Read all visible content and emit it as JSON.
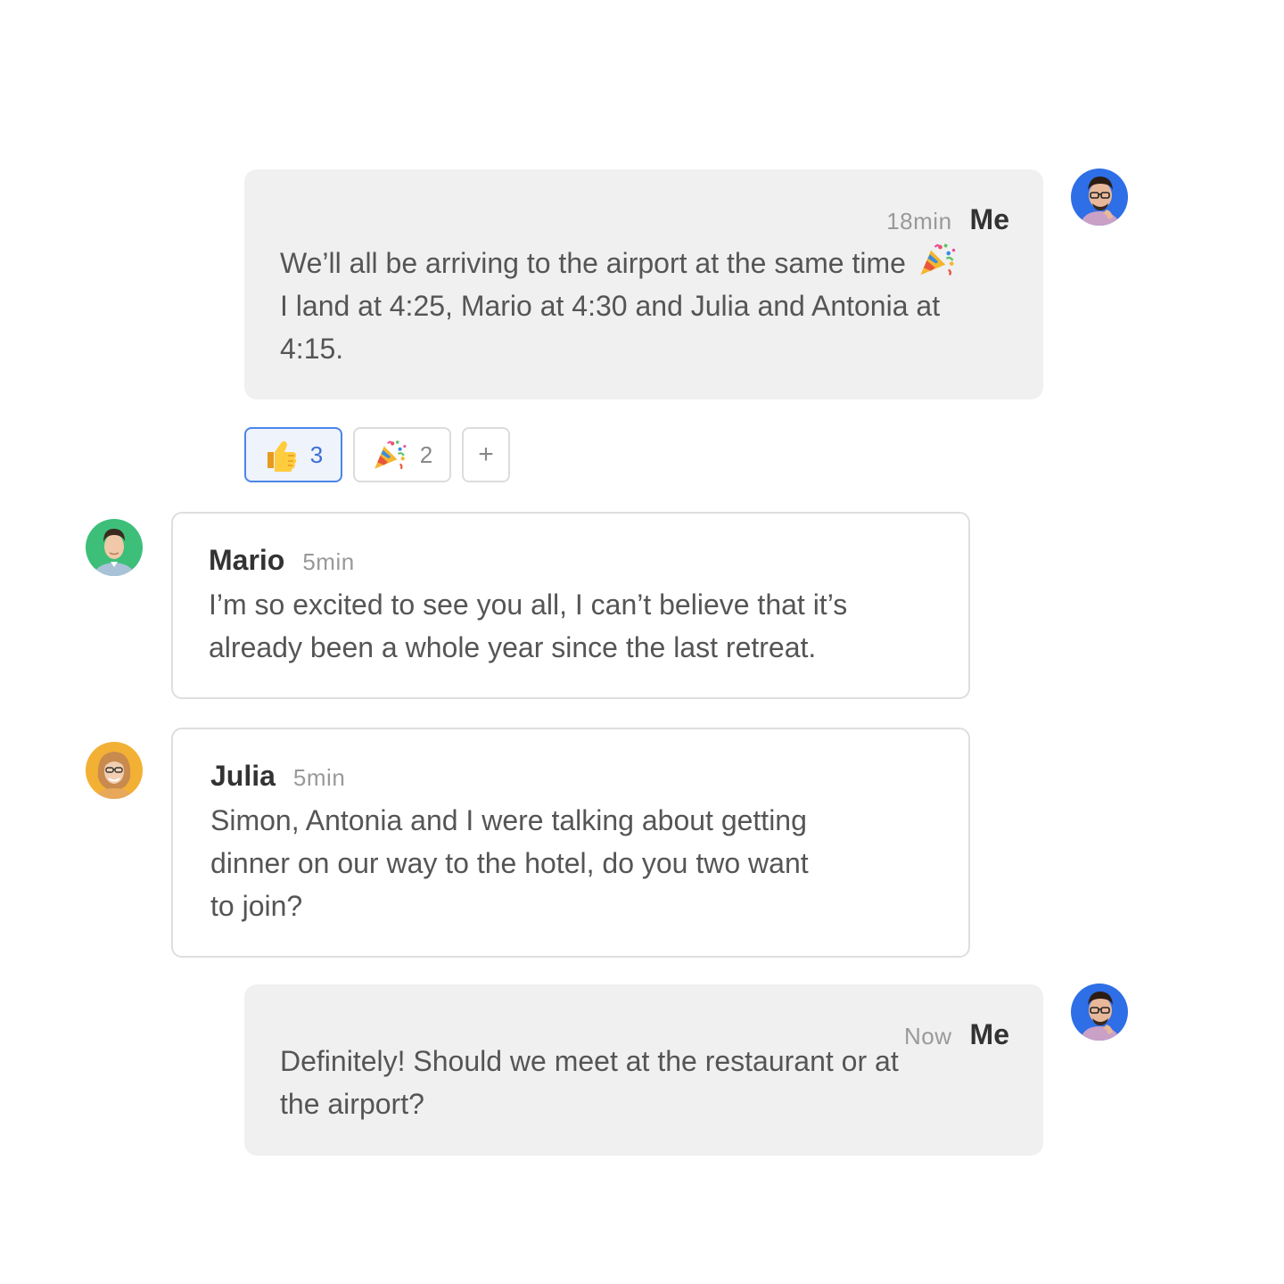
{
  "messages": [
    {
      "sender": "Me",
      "time": "18min",
      "lines": [
        "We’ll all be arriving to the airport at the same time",
        "I land at 4:25, Mario at 4:30 and Julia and Antonia at",
        "4:15."
      ],
      "emoji_icon": "party-popper-icon"
    },
    {
      "sender": "Mario",
      "time": "5min",
      "lines": [
        "I’m so excited to see you all, I can’t believe that it’s",
        "already been a whole year since the last retreat."
      ]
    },
    {
      "sender": "Julia",
      "time": "5min",
      "lines": [
        "Simon, Antonia and I were talking about getting",
        "dinner on our way to the hotel, do you two want",
        "to join?"
      ]
    },
    {
      "sender": "Me",
      "time": "Now",
      "lines": [
        "Definitely! Should we meet at the restaurant or at",
        "the airport?"
      ]
    }
  ],
  "reactions": [
    {
      "icon": "thumbs-up-icon",
      "count": "3",
      "active": true
    },
    {
      "icon": "party-popper-icon",
      "count": "2",
      "active": false
    },
    {
      "label": "+",
      "icon": "add-reaction-icon"
    }
  ],
  "colors": {
    "me_bubble": "#f0f0f0",
    "other_border": "#dedede",
    "active_reaction_border": "#4a86e8",
    "mario_avatar_bg": "#3dbf7a",
    "julia_avatar_bg": "#f2b035",
    "me_avatar_bg": "#2e6ee6"
  }
}
